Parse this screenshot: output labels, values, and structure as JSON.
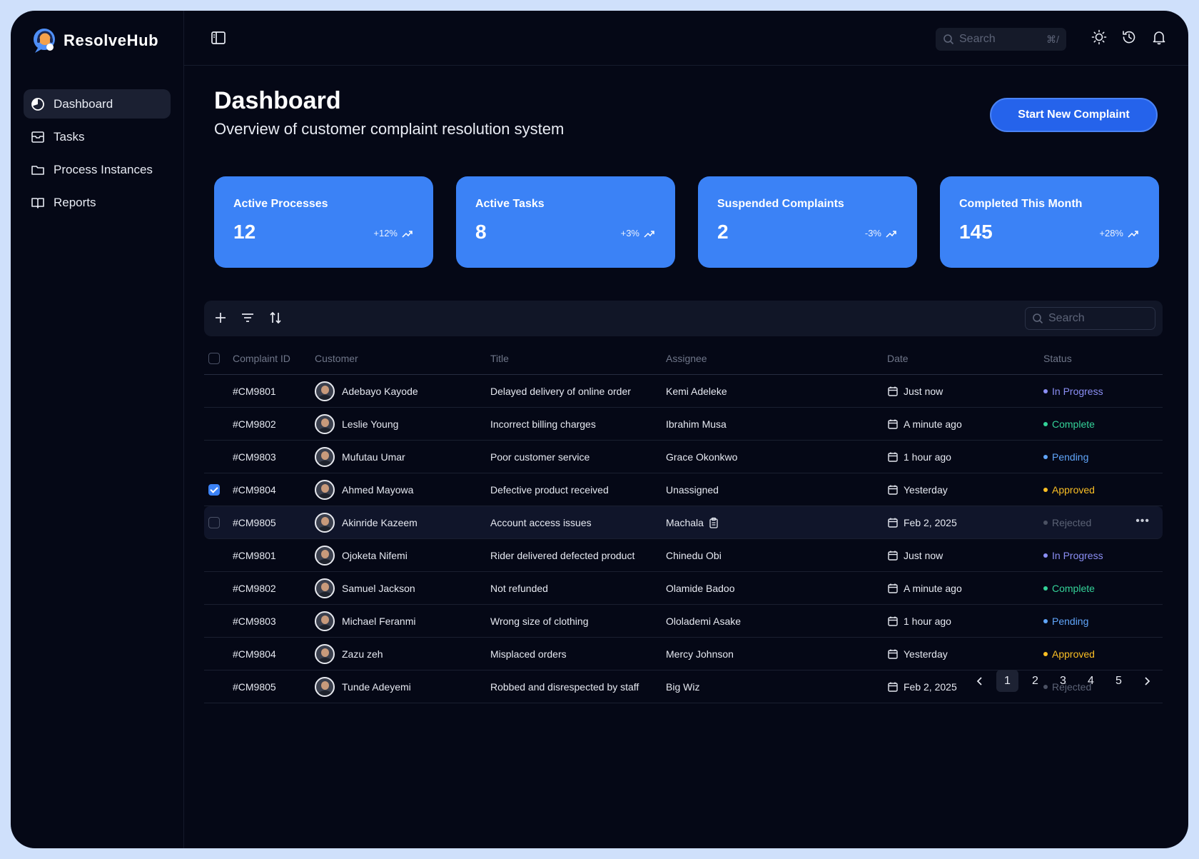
{
  "brand": {
    "name": "ResolveHub"
  },
  "sidebar": {
    "items": [
      {
        "label": "Dashboard",
        "icon": "pie-chart-icon",
        "active": true
      },
      {
        "label": "Tasks",
        "icon": "inbox-icon",
        "active": false
      },
      {
        "label": "Process Instances",
        "icon": "folder-icon",
        "active": false
      },
      {
        "label": "Reports",
        "icon": "book-icon",
        "active": false
      }
    ]
  },
  "topbar": {
    "search_placeholder": "Search",
    "search_shortcut": "⌘/",
    "icons": [
      "sun-icon",
      "history-icon",
      "bell-icon"
    ]
  },
  "header": {
    "title": "Dashboard",
    "subtitle": "Overview of customer complaint resolution system",
    "cta_label": "Start New Complaint"
  },
  "stats": [
    {
      "label": "Active Processes",
      "value": "12",
      "trend": "+12%"
    },
    {
      "label": "Active Tasks",
      "value": "8",
      "trend": "+3%"
    },
    {
      "label": "Suspended Complaints",
      "value": "2",
      "trend": "-3%"
    },
    {
      "label": "Completed This Month",
      "value": "145",
      "trend": "+28%"
    }
  ],
  "table": {
    "search_placeholder": "Search",
    "columns": [
      "Complaint ID",
      "Customer",
      "Title",
      "Assignee",
      "Date",
      "Status"
    ],
    "rows": [
      {
        "id": "#CM9801",
        "customer": "Adebayo Kayode",
        "title": "Delayed delivery of online order",
        "assignee": "Kemi Adeleke",
        "date": "Just now",
        "status": "In Progress"
      },
      {
        "id": "#CM9802",
        "customer": "Leslie Young",
        "title": "Incorrect billing charges",
        "assignee": "Ibrahim Musa",
        "date": "A minute ago",
        "status": "Complete"
      },
      {
        "id": "#CM9803",
        "customer": "Mufutau Umar",
        "title": "Poor customer service",
        "assignee": "Grace Okonkwo",
        "date": "1 hour ago",
        "status": "Pending"
      },
      {
        "id": "#CM9804",
        "customer": "Ahmed Mayowa",
        "title": "Defective product received",
        "assignee": "Unassigned",
        "date": "Yesterday",
        "status": "Approved"
      },
      {
        "id": "#CM9805",
        "customer": "Akinride Kazeem",
        "title": "Account access issues",
        "assignee": "Machala",
        "date": "Feb 2, 2025",
        "status": "Rejected"
      },
      {
        "id": "#CM9801",
        "customer": "Ojoketa Nifemi",
        "title": "Rider delivered defected product",
        "assignee": "Chinedu Obi",
        "date": "Just now",
        "status": "In Progress"
      },
      {
        "id": "#CM9802",
        "customer": "Samuel Jackson",
        "title": "Not refunded",
        "assignee": "Olamide Badoo",
        "date": "A minute ago",
        "status": "Complete"
      },
      {
        "id": "#CM9803",
        "customer": "Michael Feranmi",
        "title": "Wrong size of clothing",
        "assignee": "Ololademi Asake",
        "date": "1 hour ago",
        "status": "Pending"
      },
      {
        "id": "#CM9804",
        "customer": "Zazu zeh",
        "title": "Misplaced orders",
        "assignee": "Mercy Johnson",
        "date": "Yesterday",
        "status": "Approved"
      },
      {
        "id": "#CM9805",
        "customer": "Tunde Adeyemi",
        "title": "Robbed and disrespected by staff",
        "assignee": "Big Wiz",
        "date": "Feb 2, 2025",
        "status": "Rejected"
      }
    ]
  },
  "status_colors": {
    "In Progress": "#8b8ff5",
    "Complete": "#34d399",
    "Pending": "#60a5fa",
    "Approved": "#fbbf24",
    "Rejected": "#4b5163"
  },
  "pagination": {
    "pages": [
      "1",
      "2",
      "3",
      "4",
      "5"
    ],
    "current": "1"
  },
  "colors": {
    "background": "#050816",
    "accent": "#3b82f6",
    "cta": "#2563eb"
  }
}
